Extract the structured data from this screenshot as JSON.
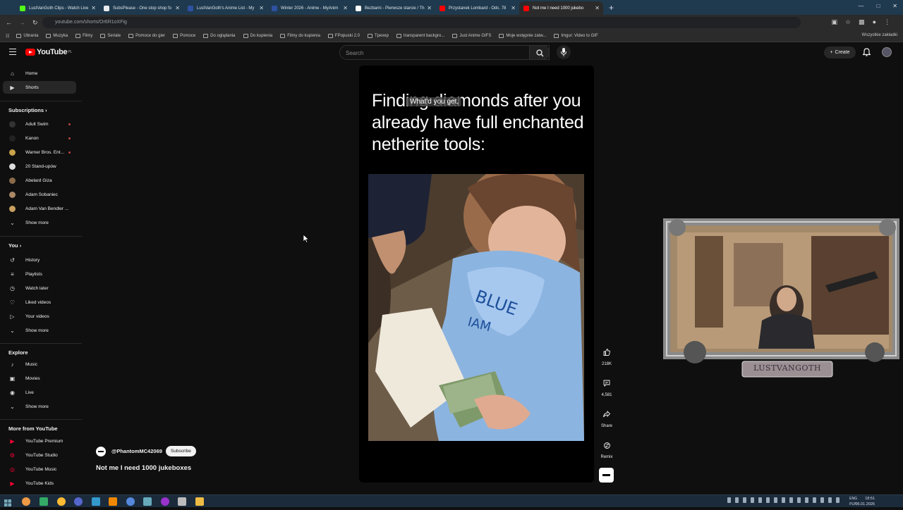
{
  "browser": {
    "tabs": [
      {
        "label": "LustVanGoth Clips - Watch Live",
        "color": "#53fc18"
      },
      {
        "label": "SubsPlease - One stop shop fo",
        "color": "#e8eaed"
      },
      {
        "label": "LustVanGoth's Anime List - My",
        "color": "#2e51a2"
      },
      {
        "label": "Winter 2026 - Anime - MyAnim",
        "color": "#2e51a2"
      },
      {
        "label": "Bezbarni - Pierwsze starcie / Th",
        "color": "#ffffff"
      },
      {
        "label": "Przystanek Lombard - Odc. 78",
        "color": "#ff0000"
      },
      {
        "label": "Not me I need 1000 jukebo",
        "color": "#ff0000"
      }
    ],
    "url": "youtube.com/shorts/Or6R1oXFig",
    "bookmarks": [
      "Ubrania",
      "Muzyka",
      "Filmy",
      "Seriale",
      "Pomoce do gier",
      "Pomoce",
      "Do oglądania",
      "Do kupienia",
      "Filmy do kupienia",
      "FPopuski 2.0",
      "Tpexep",
      "transparent backgro...",
      "Just Anime GIFS",
      "Moje wstępnie zatw...",
      "Imgur: Video to GIF"
    ],
    "bookmarks_right": "Wszystkie zakładki"
  },
  "header": {
    "logo_text": "YouTube",
    "logo_region": "PL",
    "search_placeholder": "Search",
    "create_label": "Create"
  },
  "sidebar": {
    "top": [
      {
        "label": "Home",
        "icon": "home-icon"
      },
      {
        "label": "Shorts",
        "icon": "shorts-icon",
        "selected": true
      }
    ],
    "subscriptions_heading": "Subscriptions",
    "subscriptions": [
      {
        "label": "Adult Swim",
        "color": "#333333"
      },
      {
        "label": "Kanon",
        "color": "#222222"
      },
      {
        "label": "Warner Bros. Ent...",
        "color": "#c8a24a"
      },
      {
        "label": "20 Stand-upów",
        "color": "#dddddd"
      },
      {
        "label": "Abelard Giza",
        "color": "#8a6a4a"
      },
      {
        "label": "Adam Sobaniec",
        "color": "#aa8866"
      },
      {
        "label": "Adam Van Bendler ...",
        "color": "#c9a060"
      }
    ],
    "subscriptions_more": "Show more",
    "you_heading": "You",
    "you": [
      {
        "label": "History",
        "icon": "history-icon"
      },
      {
        "label": "Playlists",
        "icon": "playlists-icon"
      },
      {
        "label": "Watch later",
        "icon": "watch-later-icon"
      },
      {
        "label": "Liked videos",
        "icon": "like-icon"
      },
      {
        "label": "Your videos",
        "icon": "your-videos-icon"
      }
    ],
    "you_more": "Show more",
    "explore_heading": "Explore",
    "explore": [
      {
        "label": "Music",
        "icon": "music-icon"
      },
      {
        "label": "Movies",
        "icon": "movies-icon"
      },
      {
        "label": "Live",
        "icon": "live-icon"
      }
    ],
    "explore_more": "Show more",
    "more_heading": "More from YouTube",
    "more": [
      {
        "label": "YouTube Premium",
        "icon": "youtube-premium-icon"
      },
      {
        "label": "YouTube Studio",
        "icon": "youtube-studio-icon"
      },
      {
        "label": "YouTube Music",
        "icon": "youtube-music-icon"
      },
      {
        "label": "YouTube Kids",
        "icon": "youtube-kids-icon"
      }
    ]
  },
  "short": {
    "overlay_text": "Finding diamonds after you already have full enchanted netherite tools:",
    "subtitle": "What'd you get,",
    "channel": "@PhantomMC42069",
    "subscribe_label": "Subscribe",
    "title": "Not me I need 1000 jukeboxes",
    "likes": "218K",
    "comments": "4,581",
    "share_label": "Share",
    "remix_label": "Remix"
  },
  "webcam": {
    "nameplate": "LUSTVANGOTH"
  },
  "taskbar": {
    "time": "18:51",
    "date": "06.01.2026",
    "lang_top": "ENG",
    "lang_bottom": "PLP"
  }
}
